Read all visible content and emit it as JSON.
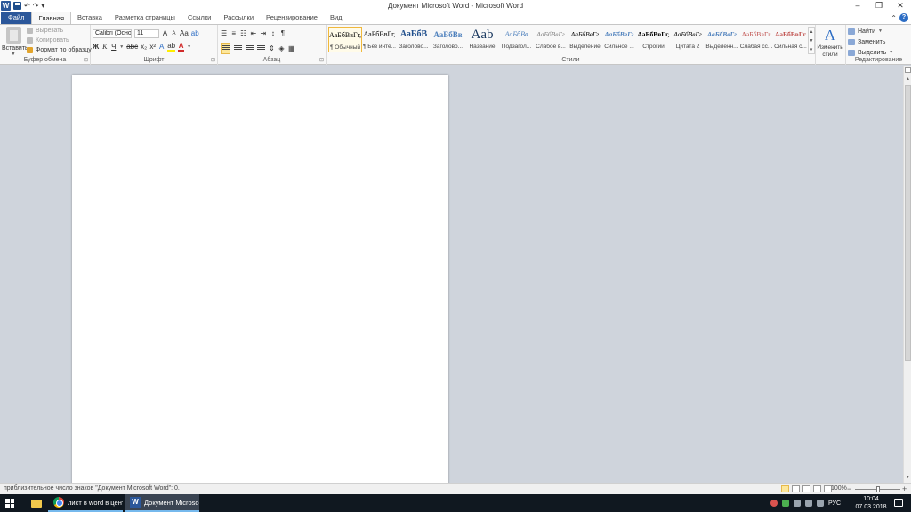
{
  "window": {
    "title": "Документ Microsoft Word - Microsoft Word",
    "app_icon_letter": "W",
    "qat": {
      "undo": "↶",
      "redo": "↷",
      "customize": "▾"
    },
    "controls": {
      "minimize": "–",
      "restore": "❐",
      "close": "✕"
    }
  },
  "tabs": [
    {
      "label": "Файл"
    },
    {
      "label": "Главная"
    },
    {
      "label": "Вставка"
    },
    {
      "label": "Разметка страницы"
    },
    {
      "label": "Ссылки"
    },
    {
      "label": "Рассылки"
    },
    {
      "label": "Рецензирование"
    },
    {
      "label": "Вид"
    }
  ],
  "help": {
    "chevron": "⌃",
    "icon": "?"
  },
  "clipboard": {
    "paste": "Вставить",
    "cut": "Вырезать",
    "copy": "Копировать",
    "format_painter": "Формат по образцу",
    "label": "Буфер обмена"
  },
  "font": {
    "name": "Calibri (Осно",
    "size": "11",
    "grow": "A",
    "shrink": "A",
    "case": "Aa",
    "clear": "ab",
    "bold": "Ж",
    "italic": "К",
    "underline": "Ч",
    "strike": "abc",
    "subscript": "x₂",
    "superscript": "x²",
    "effects": "A",
    "highlight": "ab",
    "color": "A",
    "label": "Шрифт"
  },
  "paragraph": {
    "pilcrow": "¶",
    "label": "Абзац"
  },
  "styles": {
    "label": "Стили",
    "items": [
      {
        "preview": "АаБбВвГг,",
        "name": "¶ Обычный",
        "color": "#000000",
        "size": "8px",
        "weight": "normal",
        "style": "normal"
      },
      {
        "preview": "АаБбВвГг,",
        "name": "¶ Без инте...",
        "color": "#000000",
        "size": "8px",
        "weight": "normal",
        "style": "normal"
      },
      {
        "preview": "АаБбВ",
        "name": "Заголово...",
        "color": "#1f4e8c",
        "size": "10px",
        "weight": "bold",
        "style": "normal"
      },
      {
        "preview": "АаБбВв",
        "name": "Заголово...",
        "color": "#4f81bd",
        "size": "9px",
        "weight": "bold",
        "style": "normal"
      },
      {
        "preview": "Aab",
        "name": "Название",
        "color": "#17365d",
        "size": "15px",
        "weight": "normal",
        "style": "normal"
      },
      {
        "preview": "АаБбВв",
        "name": "Подзагол...",
        "color": "#4f81bd",
        "size": "8px",
        "weight": "normal",
        "style": "italic"
      },
      {
        "preview": "АаБбВвГг",
        "name": "Слабое в...",
        "color": "#808080",
        "size": "7.5px",
        "weight": "normal",
        "style": "italic"
      },
      {
        "preview": "АаБбВвГг",
        "name": "Выделение",
        "color": "#000000",
        "size": "7.5px",
        "weight": "normal",
        "style": "italic"
      },
      {
        "preview": "АаБбВвГг",
        "name": "Сильное ...",
        "color": "#4f81bd",
        "size": "7.5px",
        "weight": "bold",
        "style": "italic"
      },
      {
        "preview": "АаБбВвГг,",
        "name": "Строгий",
        "color": "#000000",
        "size": "7.5px",
        "weight": "bold",
        "style": "normal"
      },
      {
        "preview": "АаБбВвГг",
        "name": "Цитата 2",
        "color": "#000000",
        "size": "7.5px",
        "weight": "normal",
        "style": "italic"
      },
      {
        "preview": "АаБбВвГг",
        "name": "Выделенн...",
        "color": "#4f81bd",
        "size": "7.5px",
        "weight": "bold",
        "style": "italic"
      },
      {
        "preview": "АаБбВвГг",
        "name": "Слабая сс...",
        "color": "#c0504d",
        "size": "7.5px",
        "weight": "normal",
        "style": "normal"
      },
      {
        "preview": "АаБбВвГг",
        "name": "Сильная с...",
        "color": "#c0504d",
        "size": "7.5px",
        "weight": "bold",
        "style": "normal"
      }
    ],
    "change_icon": "A",
    "change_label": "Изменить стили"
  },
  "editing": {
    "find": "Найти",
    "replace": "Заменить",
    "select": "Выделить",
    "label": "Редактирование"
  },
  "statusbar": {
    "text": "приблизительное число знаков \"Документ Microsoft Word\": 0.",
    "zoom": "100%",
    "zoom_level_fraction": 0.5
  },
  "taskbar": {
    "tasks": [
      {
        "label": "лист в word в цент..."
      },
      {
        "label": "Документ Microso..."
      }
    ],
    "lang": "РУС",
    "time": "10:04",
    "date": "07.03.2018"
  }
}
